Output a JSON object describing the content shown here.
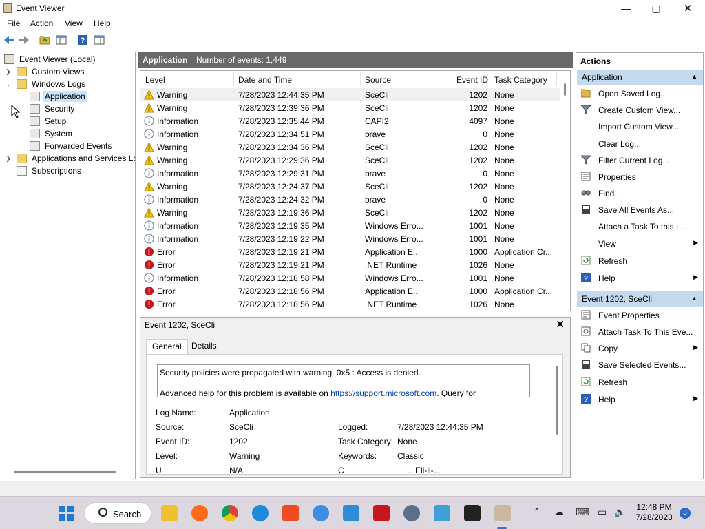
{
  "window": {
    "title": "Event Viewer",
    "minimize": "—",
    "maximize": "▢",
    "close": "✕"
  },
  "menu": [
    "File",
    "Action",
    "View",
    "Help"
  ],
  "tree": [
    {
      "label": "Event Viewer (Local)",
      "icon": "event-viewer-icon"
    },
    {
      "label": "Custom Views",
      "icon": "folder-icon"
    },
    {
      "label": "Windows Logs",
      "icon": "windows-logs-icon"
    },
    {
      "label": "Application",
      "icon": "log-icon",
      "selected": true
    },
    {
      "label": "Security",
      "icon": "log-icon"
    },
    {
      "label": "Setup",
      "icon": "log-icon"
    },
    {
      "label": "System",
      "icon": "log-icon"
    },
    {
      "label": "Forwarded Events",
      "icon": "log-icon"
    },
    {
      "label": "Applications and Services Lo",
      "icon": "folder-icon"
    },
    {
      "label": "Subscriptions",
      "icon": "subscriptions-icon"
    }
  ],
  "center": {
    "log_name": "Application",
    "count_text": "Number of events: 1,449"
  },
  "columns": [
    "Level",
    "Date and Time",
    "Source",
    "Event ID",
    "Task Category"
  ],
  "events": [
    {
      "level": "Warning",
      "datetime": "7/28/2023 12:44:35 PM",
      "source": "SceCli",
      "event_id": "1202",
      "category": "None"
    },
    {
      "level": "Warning",
      "datetime": "7/28/2023 12:39:36 PM",
      "source": "SceCli",
      "event_id": "1202",
      "category": "None"
    },
    {
      "level": "Information",
      "datetime": "7/28/2023 12:35:44 PM",
      "source": "CAPI2",
      "event_id": "4097",
      "category": "None"
    },
    {
      "level": "Information",
      "datetime": "7/28/2023 12:34:51 PM",
      "source": "brave",
      "event_id": "0",
      "category": "None"
    },
    {
      "level": "Warning",
      "datetime": "7/28/2023 12:34:36 PM",
      "source": "SceCli",
      "event_id": "1202",
      "category": "None"
    },
    {
      "level": "Warning",
      "datetime": "7/28/2023 12:29:36 PM",
      "source": "SceCli",
      "event_id": "1202",
      "category": "None"
    },
    {
      "level": "Information",
      "datetime": "7/28/2023 12:29:31 PM",
      "source": "brave",
      "event_id": "0",
      "category": "None"
    },
    {
      "level": "Warning",
      "datetime": "7/28/2023 12:24:37 PM",
      "source": "SceCli",
      "event_id": "1202",
      "category": "None"
    },
    {
      "level": "Information",
      "datetime": "7/28/2023 12:24:32 PM",
      "source": "brave",
      "event_id": "0",
      "category": "None"
    },
    {
      "level": "Warning",
      "datetime": "7/28/2023 12:19:36 PM",
      "source": "SceCli",
      "event_id": "1202",
      "category": "None"
    },
    {
      "level": "Information",
      "datetime": "7/28/2023 12:19:35 PM",
      "source": "Windows Erro...",
      "event_id": "1001",
      "category": "None"
    },
    {
      "level": "Information",
      "datetime": "7/28/2023 12:19:22 PM",
      "source": "Windows Erro...",
      "event_id": "1001",
      "category": "None"
    },
    {
      "level": "Error",
      "datetime": "7/28/2023 12:19:21 PM",
      "source": "Application E...",
      "event_id": "1000",
      "category": "Application Cr..."
    },
    {
      "level": "Error",
      "datetime": "7/28/2023 12:19:21 PM",
      "source": ".NET Runtime",
      "event_id": "1026",
      "category": "None"
    },
    {
      "level": "Information",
      "datetime": "7/28/2023 12:18:58 PM",
      "source": "Windows Erro...",
      "event_id": "1001",
      "category": "None"
    },
    {
      "level": "Error",
      "datetime": "7/28/2023 12:18:56 PM",
      "source": "Application E...",
      "event_id": "1000",
      "category": "Application Cr..."
    },
    {
      "level": "Error",
      "datetime": "7/28/2023 12:18:56 PM",
      "source": ".NET Runtime",
      "event_id": "1026",
      "category": "None"
    }
  ],
  "detail": {
    "title": "Event 1202, SceCli",
    "close": "✕",
    "tabs": [
      "General",
      "Details"
    ],
    "message_line1": "Security policies were propagated with warning. 0x5 : Access is denied.",
    "message_line2_prefix": "Advanced help for this problem is available on ",
    "message_link": "https://support.microsoft.com",
    "message_line2_suffix": ". Query for",
    "fields": {
      "log_name_label": "Log Name:",
      "log_name": "Application",
      "source_label": "Source:",
      "source": "SceCli",
      "logged_label": "Logged:",
      "logged": "7/28/2023 12:44:35 PM",
      "event_id_label": "Event ID:",
      "event_id": "1202",
      "task_category_label": "Task Category:",
      "task_category": "None",
      "level_label": "Level:",
      "level": "Warning",
      "keywords_label": "Keywords:",
      "keywords": "Classic",
      "user_label": "U",
      "user": "N/A",
      "computer_label": "C",
      "computer": "...Ell-ll-..."
    }
  },
  "actions": {
    "title": "Actions",
    "section1": "Application",
    "items1": [
      {
        "label": "Open Saved Log...",
        "icon": "open-log-icon"
      },
      {
        "label": "Create Custom View...",
        "icon": "filter-icon"
      },
      {
        "label": "Import Custom View...",
        "icon": ""
      },
      {
        "label": "Clear Log...",
        "icon": ""
      },
      {
        "label": "Filter Current Log...",
        "icon": "filter-icon"
      },
      {
        "label": "Properties",
        "icon": "properties-icon"
      },
      {
        "label": "Find...",
        "icon": "find-icon"
      },
      {
        "label": "Save All Events As...",
        "icon": "save-icon"
      },
      {
        "label": "Attach a Task To this L...",
        "icon": ""
      },
      {
        "label": "View",
        "icon": "",
        "submenu": true
      },
      {
        "label": "Refresh",
        "icon": "refresh-icon"
      },
      {
        "label": "Help",
        "icon": "help-icon",
        "submenu": true
      }
    ],
    "section2": "Event 1202, SceCli",
    "items2": [
      {
        "label": "Event Properties",
        "icon": "properties-icon"
      },
      {
        "label": "Attach Task To This Eve...",
        "icon": "task-icon"
      },
      {
        "label": "Copy",
        "icon": "copy-icon",
        "submenu": true
      },
      {
        "label": "Save Selected Events...",
        "icon": "save-icon"
      },
      {
        "label": "Refresh",
        "icon": "refresh-icon"
      },
      {
        "label": "Help",
        "icon": "help-icon",
        "submenu": true
      }
    ]
  },
  "taskbar": {
    "search_label": "Search",
    "time": "12:48 PM",
    "date": "7/28/2023",
    "notification_count": "3"
  },
  "colors": {
    "accent": "#c5d9ed",
    "selected": "#cce4f7",
    "header_gray": "#696969",
    "warning": "#f2c811",
    "error": "#c4171d",
    "info": "#5a6b8c"
  }
}
